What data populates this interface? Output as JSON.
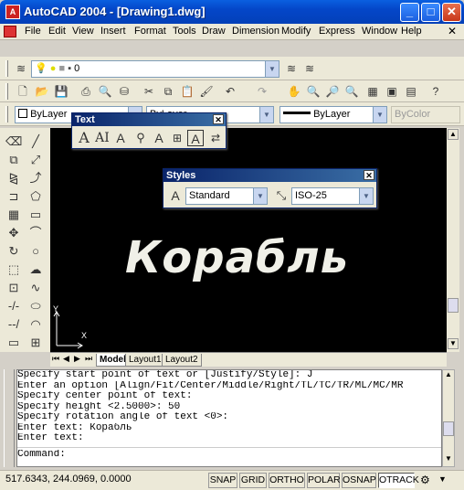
{
  "window": {
    "title": "AutoCAD 2004 - [Drawing1.dwg]",
    "app_icon": "A",
    "minimize": "_",
    "maximize": "□",
    "close": "✕"
  },
  "menu": [
    "File",
    "Edit",
    "View",
    "Insert",
    "Format",
    "Tools",
    "Draw",
    "Dimension",
    "Modify",
    "Express",
    "Window",
    "Help"
  ],
  "layer_combo": {
    "value": "0"
  },
  "properties": {
    "color": "ByLayer",
    "linetype": "ByLayer",
    "lineweight": "ByLayer",
    "plotstyle": "ByColor"
  },
  "text_toolbar": {
    "title": "Text"
  },
  "styles_toolbar": {
    "title": "Styles",
    "text_style": "Standard",
    "dim_style": "ISO-25"
  },
  "drawing": {
    "text": "Корабль",
    "ucs_y": "Y",
    "ucs_x": "X"
  },
  "tabs": [
    "Model",
    "Layout1",
    "Layout2"
  ],
  "command_history": [
    "Specify start point of text or [Justify/Style]: J",
    "Enter an option [Align/Fit/Center/Middle/Right/TL/TC/TR/ML/MC/MR",
    "Specify center point of text:",
    "Specify height <2.5000>: 50",
    "Specify rotation angle of text <0>:",
    "Enter text: Корабль",
    "Enter text:"
  ],
  "command_prompt": "Command:",
  "status": {
    "coords": "517.6343, 244.0969, 0.0000",
    "buttons": [
      "SNAP",
      "GRID",
      "ORTHO",
      "POLAR",
      "OSNAP",
      "OTRACK"
    ]
  }
}
